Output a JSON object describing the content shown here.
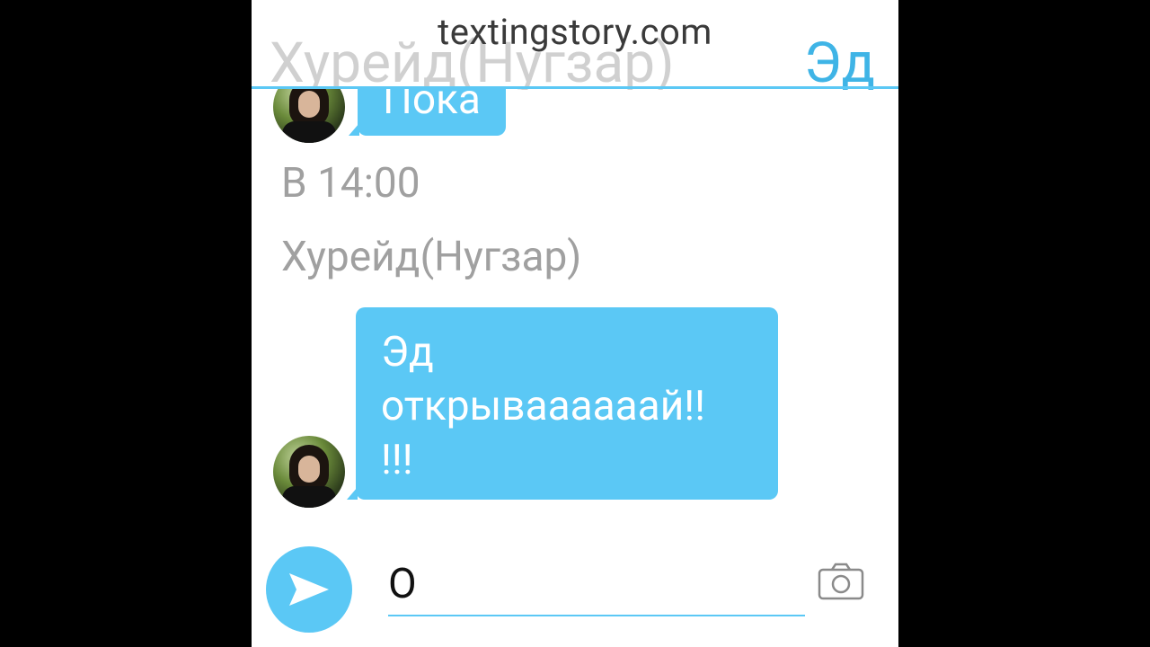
{
  "header": {
    "watermark": "textingstory.com",
    "contact_name": "Хурейд(Нугзар)",
    "right_name": "Эд"
  },
  "messages": [
    {
      "type": "incoming",
      "text": "Пока"
    },
    {
      "type": "system",
      "text": "В 14:00"
    },
    {
      "type": "system",
      "text": "Хурейд(Нугзар)"
    },
    {
      "type": "incoming",
      "lines": [
        "Эд",
        "открываааааай!!",
        "!!!"
      ]
    }
  ],
  "composer": {
    "value": "О",
    "send_icon": "send-arrow-icon",
    "camera_icon": "camera-icon"
  },
  "colors": {
    "accent": "#5bc8f5",
    "header_name": "#c8c8c8",
    "right_name": "#3fb4e6",
    "system_text": "#a0a0a0"
  }
}
